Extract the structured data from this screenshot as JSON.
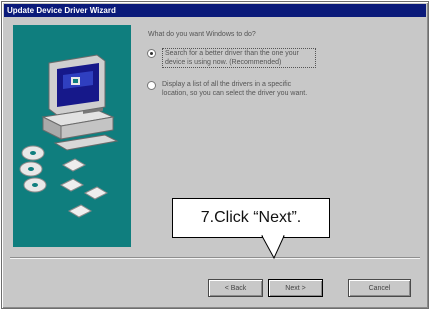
{
  "window": {
    "title": "Update Device Driver Wizard"
  },
  "content": {
    "question": "What do you want Windows to do?",
    "options": [
      {
        "label": "Search for a better driver than the one your device is using now. (Recommended)",
        "selected": true
      },
      {
        "label": "Display a list of all the drivers in a specific location, so you can select the driver you want.",
        "selected": false
      }
    ]
  },
  "buttons": {
    "back": "< Back",
    "next": "Next >",
    "cancel": "Cancel"
  },
  "callout": {
    "text": "7.Click “Next”."
  },
  "colors": {
    "titlebar": "#0a1a7a",
    "dialog_face": "#c8c8c8",
    "illustration_bg": "#0f7e7e"
  }
}
